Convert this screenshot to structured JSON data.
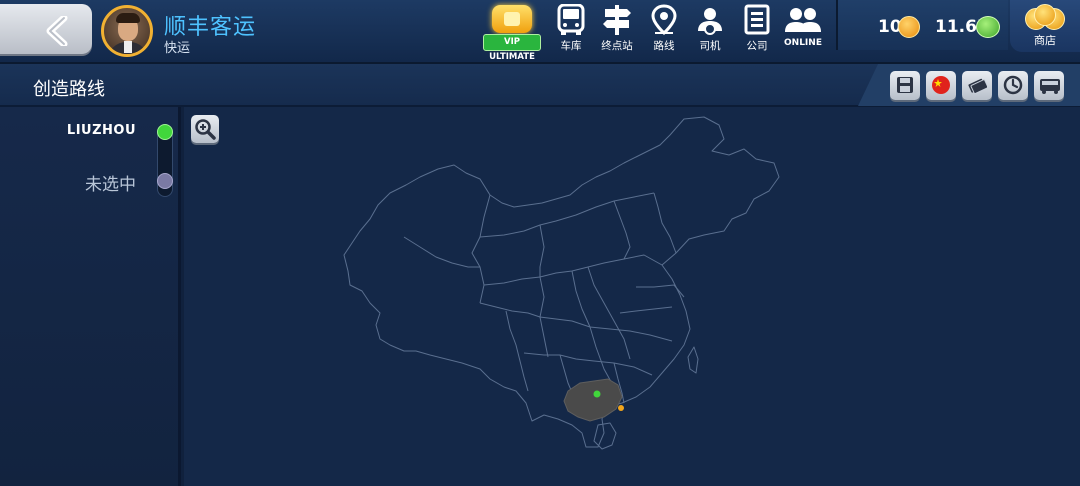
{
  "header": {
    "company_name": "顺丰客运",
    "company_sub": "快运",
    "vip_label": "VIP ULTIMATE",
    "nav": [
      {
        "id": "garage",
        "label": "车库",
        "icon": "bus-icon"
      },
      {
        "id": "terminal",
        "label": "终点站",
        "icon": "signpost-icon"
      },
      {
        "id": "routes",
        "label": "路线",
        "icon": "map-pin-icon"
      },
      {
        "id": "drivers",
        "label": "司机",
        "icon": "driver-icon"
      },
      {
        "id": "company",
        "label": "公司",
        "icon": "company-icon"
      },
      {
        "id": "online",
        "label": "ONLINE",
        "icon": "users-icon"
      }
    ],
    "coins": "10",
    "cash": "11.6K",
    "shop_label": "商店"
  },
  "subheader": {
    "title": "创造路线",
    "tools": [
      "save-icon",
      "china-flag-icon",
      "tickets-icon",
      "clock-icon",
      "bus-front-icon"
    ]
  },
  "route": {
    "stops": [
      {
        "label": "LIUZHOU",
        "state": "selected",
        "color": "#41d63b"
      },
      {
        "label": "未选中",
        "state": "unselected",
        "color": "#7a7aa4"
      }
    ]
  },
  "map": {
    "region": "china",
    "highlight_province": "guangxi",
    "city_marker_color": "#41d63b",
    "secondary_marker_color": "#f2a51c"
  }
}
